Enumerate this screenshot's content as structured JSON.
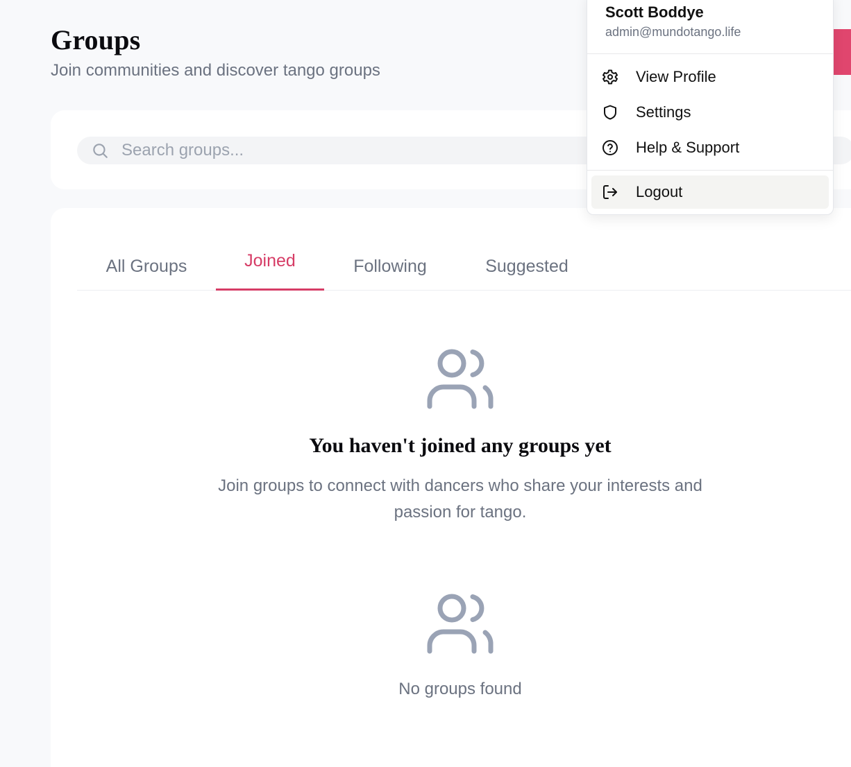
{
  "header": {
    "title": "Groups",
    "subtitle": "Join communities and discover tango groups"
  },
  "search": {
    "placeholder": "Search groups...",
    "value": ""
  },
  "tabs": [
    {
      "label": "All Groups",
      "active": false
    },
    {
      "label": "Joined",
      "active": true
    },
    {
      "label": "Following",
      "active": false
    },
    {
      "label": "Suggested",
      "active": false
    }
  ],
  "empty_state": {
    "icon": "users-icon",
    "title": "You haven't joined any groups yet",
    "description": "Join groups to connect with dancers who share your interests and passion for tango."
  },
  "results": {
    "icon": "users-icon",
    "message": "No groups found"
  },
  "user_menu": {
    "name": "Scott Boddye",
    "email": "admin@mundotango.life",
    "items": [
      {
        "label": "View Profile",
        "icon": "gear-icon"
      },
      {
        "label": "Settings",
        "icon": "shield-icon"
      },
      {
        "label": "Help & Support",
        "icon": "help-circle-icon"
      },
      {
        "label": "Logout",
        "icon": "logout-icon",
        "highlighted": true
      }
    ]
  },
  "colors": {
    "accent": "#d63c66",
    "muted_text": "#6b7280",
    "icon_gray": "#9aa3b5",
    "background": "#f8f9fb"
  }
}
